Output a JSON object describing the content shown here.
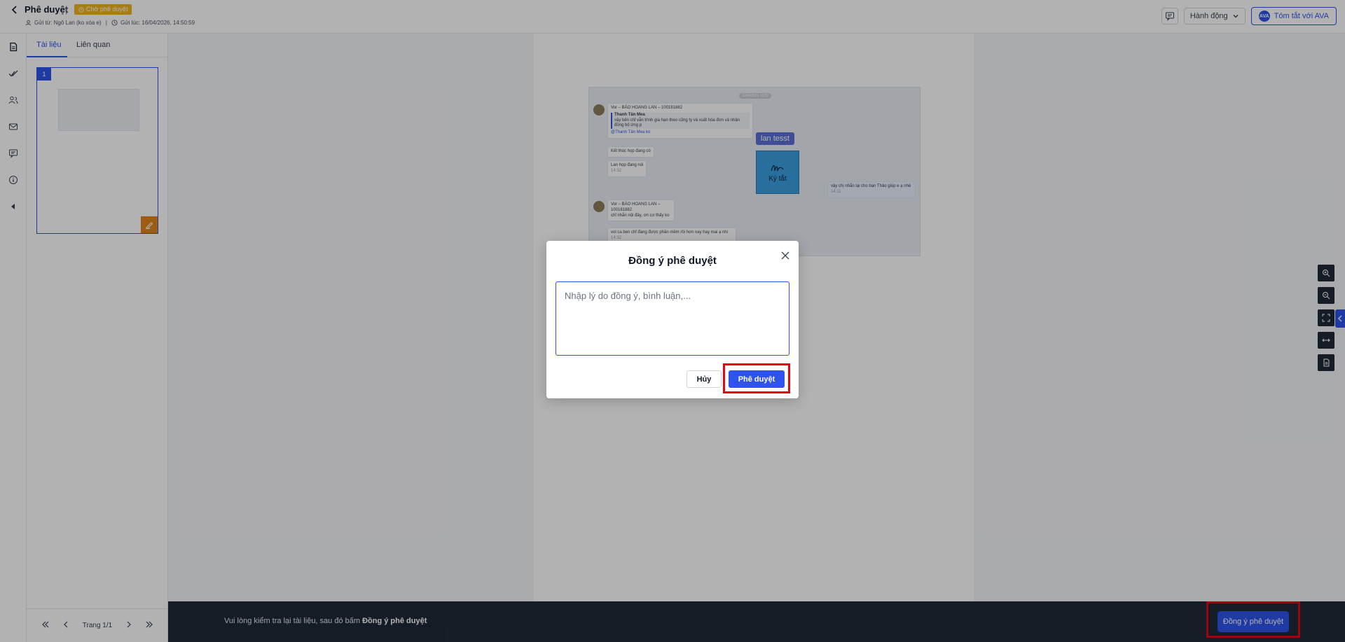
{
  "header": {
    "title": "Phê duyệt",
    "status_badge": "Chờ phê duyệt",
    "sender_label": "Gửi từ: Ngô Lan (ko xóa e)",
    "sent_time_label": "Gửi lúc: 16/04/2026, 14:50:59",
    "actions_label": "Hành động",
    "ava_label": "Tóm tắt với AVA",
    "ava_logo": "AVA"
  },
  "sidepanel": {
    "tabs": [
      {
        "label": "Tài liệu",
        "active": true
      },
      {
        "label": "Liên quan",
        "active": false
      }
    ],
    "thumbnail_number": "1",
    "pager_label": "Trang 1/1"
  },
  "document": {
    "signature_label": "lan tesst",
    "signature_caption": "Ký tắt",
    "snippet_lines": {
      "meta1": "Vor – BÀO HOANG LAN – 100181882",
      "quote_title": "Thanh Tân Mea",
      "quote_body": "vậy bên chỉ vẫn trình gia hạn theo cũng ty và xuất hóa đơn và nhận đồng bộ ứng p",
      "mention": "@Thanh Tân Mea ko",
      "msg1": "Kết thúc họp đang có",
      "msg2": "Lan họp đang nói",
      "msg2_time": "14:32",
      "right_msg": "vậy chị nhắn lại cho bạn Thảo giúp e ạ nhé",
      "right_time": "14:11",
      "meta2": "Vor – BÀO HOANG LAN – 100181882",
      "msg3": "chỉ nhắn nội đây, ơn cơ thấy ko",
      "msg4": "vol ca ben chỉ đang được phần mềm rồi hơn nay hay mai ạ nhi",
      "msg4_time": "14:32",
      "pill": "11/04/2026 10:22"
    }
  },
  "bottombar": {
    "hint_prefix": "Vui lòng kiểm tra lại tài liệu, sau đó bấm ",
    "hint_bold": "Đồng ý phê duyệt",
    "approve_label": "Đồng ý phê duyệt"
  },
  "modal": {
    "title": "Đồng ý phê duyệt",
    "placeholder": "Nhập lý do đồng ý, bình luận,...",
    "value": "",
    "cancel_label": "Hủy",
    "approve_label": "Phê duyệt"
  },
  "colors": {
    "accent": "#2f54eb",
    "status_badge": "#f2b320",
    "highlight": "#e30613",
    "bottom_bar": "#1f2937"
  },
  "icons": {
    "rail": [
      "document-icon",
      "double-check-icon",
      "users-icon",
      "mail-icon",
      "comment-icon",
      "info-icon",
      "collapse-left-icon"
    ],
    "zoom_tools": [
      "zoom-in-icon",
      "zoom-out-icon",
      "fit-screen-icon",
      "fit-width-icon",
      "page-icon"
    ]
  }
}
